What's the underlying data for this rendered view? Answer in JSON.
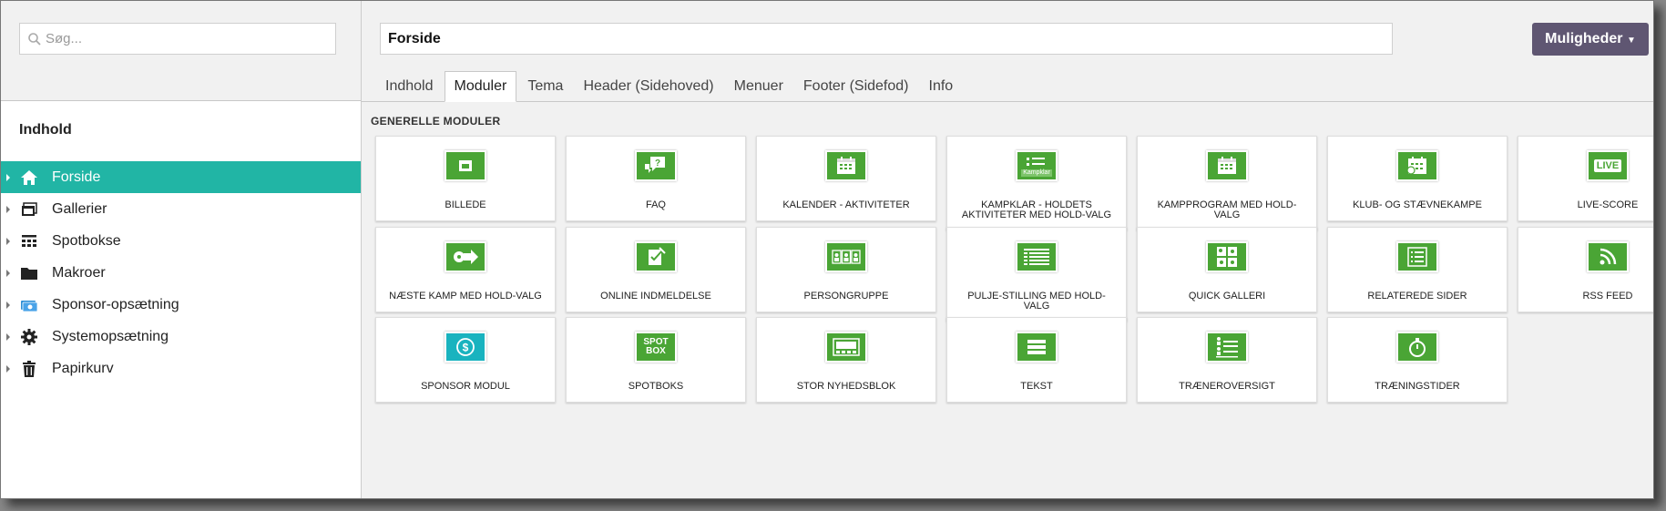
{
  "sidebar": {
    "search_placeholder": "Søg...",
    "section_title": "Indhold",
    "items": [
      {
        "label": "Forside",
        "icon": "home-icon",
        "active": true
      },
      {
        "label": "Gallerier",
        "icon": "gallery-icon",
        "active": false
      },
      {
        "label": "Spotbokse",
        "icon": "spotbox-icon",
        "active": false
      },
      {
        "label": "Makroer",
        "icon": "folder-icon",
        "active": false
      },
      {
        "label": "Sponsor-opsætning",
        "icon": "sponsor-icon",
        "active": false
      },
      {
        "label": "Systemopsætning",
        "icon": "gear-icon",
        "active": false
      },
      {
        "label": "Papirkurv",
        "icon": "trash-icon",
        "active": false
      }
    ]
  },
  "main": {
    "page_title_value": "Forside",
    "options_button": "Muligheder",
    "tabs": [
      {
        "label": "Indhold",
        "active": false
      },
      {
        "label": "Moduler",
        "active": true
      },
      {
        "label": "Tema",
        "active": false
      },
      {
        "label": "Header (Sidehoved)",
        "active": false
      },
      {
        "label": "Menuer",
        "active": false
      },
      {
        "label": "Footer (Sidefod)",
        "active": false
      },
      {
        "label": "Info",
        "active": false
      }
    ],
    "group_title": "GENERELLE MODULER",
    "modules": [
      {
        "label": "BILLEDE",
        "icon": "image-icon"
      },
      {
        "label": "FAQ",
        "icon": "faq-icon"
      },
      {
        "label": "KALENDER - AKTIVITETER",
        "icon": "calendar-icon"
      },
      {
        "label": "KAMPKLAR - HOLDETS AKTIVITETER MED HOLD-VALG",
        "icon": "kampklar-icon",
        "icon_text": "Kampklar"
      },
      {
        "label": "KAMPPROGRAM MED HOLD-VALG",
        "icon": "calendar-icon"
      },
      {
        "label": "KLUB- OG STÆVNEKAMPE",
        "icon": "calendar-alt-icon"
      },
      {
        "label": "LIVE-SCORE",
        "icon": "live-icon",
        "icon_text": "LIVE"
      },
      {
        "label": "NÆSTE KAMP MED HOLD-VALG",
        "icon": "next-match-icon"
      },
      {
        "label": "ONLINE INDMELDELSE",
        "icon": "signup-icon"
      },
      {
        "label": "PERSONGRUPPE",
        "icon": "persongroup-icon"
      },
      {
        "label": "PULJE-STILLING MED HOLD-VALG",
        "icon": "standings-icon"
      },
      {
        "label": "QUICK GALLERI",
        "icon": "quick-gallery-icon"
      },
      {
        "label": "RELATEREDE SIDER",
        "icon": "list-icon"
      },
      {
        "label": "RSS FEED",
        "icon": "rss-icon"
      },
      {
        "label": "SPONSOR MODUL",
        "icon": "sponsor-module-icon"
      },
      {
        "label": "SPOTBOKS",
        "icon": "spotbox-text-icon",
        "icon_text": "SPOT BOX"
      },
      {
        "label": "STOR NYHEDSBLOK",
        "icon": "newsblock-icon"
      },
      {
        "label": "TEKST",
        "icon": "text-icon"
      },
      {
        "label": "TRÆNEROVERSIGT",
        "icon": "coaches-icon"
      },
      {
        "label": "TRÆNINGSTIDER",
        "icon": "stopwatch-icon"
      }
    ]
  },
  "colors": {
    "accent": "#21b5a5",
    "module_green": "#4aa535",
    "module_teal": "#19b3bf",
    "button": "#5f5672"
  }
}
